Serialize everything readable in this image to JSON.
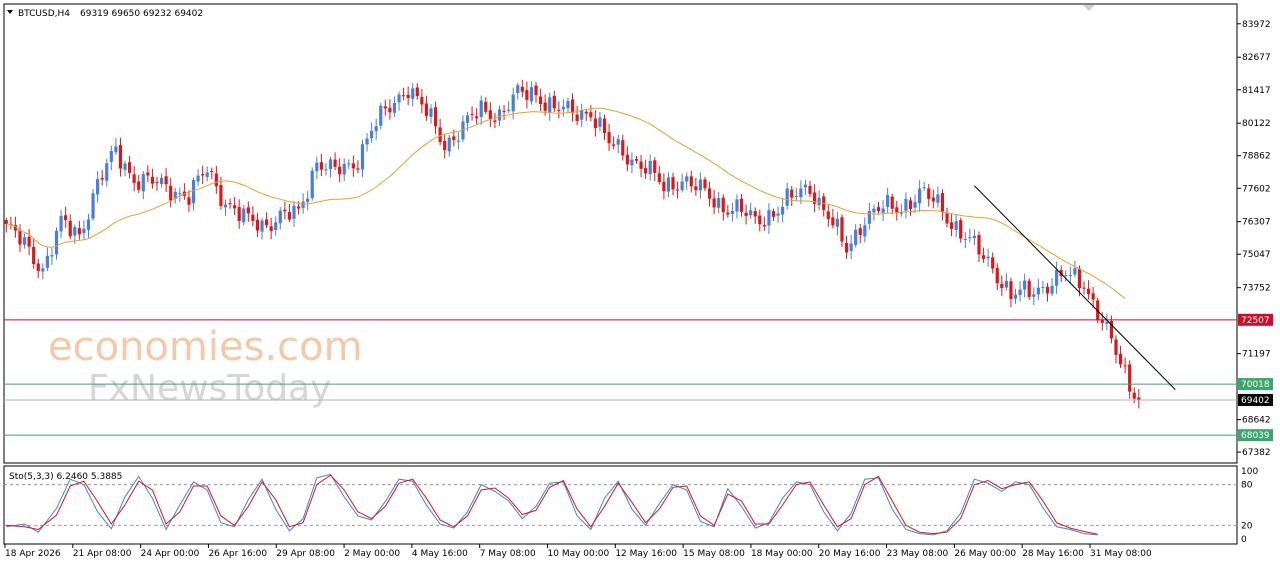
{
  "header": {
    "symbol": "BTCUSD,H4",
    "ohlc": "69319 69650 69232 69402"
  },
  "watermark": {
    "line1": "economies.com",
    "line2": "FxNewsToday"
  },
  "colors": {
    "bull": "#4a7fd4",
    "bear": "#d7191c",
    "ma": "#e8a032",
    "resistance": "#c8102e",
    "support": "#3aa86b",
    "current": "#000000",
    "trendline": "#000000",
    "stoch_main": "#4a7fd4",
    "stoch_signal": "#d7191c"
  },
  "chart_data": [
    {
      "type": "candlestick",
      "y_ticks": [
        "83972",
        "82677",
        "81417",
        "80122",
        "78862",
        "77602",
        "76307",
        "75047",
        "73752",
        "71197",
        "68642",
        "67382"
      ],
      "ylim": [
        67000,
        84700
      ],
      "x_labels": [
        "18 Apr 2026",
        "21 Apr 08:00",
        "24 Apr 00:00",
        "26 Apr 16:00",
        "29 Apr 08:00",
        "2 May 00:00",
        "4 May 16:00",
        "7 May 08:00",
        "10 May 00:00",
        "12 May 16:00",
        "15 May 08:00",
        "18 May 00:00",
        "20 May 16:00",
        "23 May 08:00",
        "26 May 00:00",
        "28 May 16:00",
        "31 May 08:00"
      ],
      "close_path": [
        [
          0,
          76100
        ],
        [
          4,
          75400
        ],
        [
          8,
          74500
        ],
        [
          12,
          76200
        ],
        [
          16,
          75800
        ],
        [
          20,
          77800
        ],
        [
          24,
          79000
        ],
        [
          28,
          78000
        ],
        [
          32,
          77800
        ],
        [
          36,
          77600
        ],
        [
          40,
          77300
        ],
        [
          44,
          78300
        ],
        [
          48,
          77100
        ],
        [
          52,
          76400
        ],
        [
          56,
          76200
        ],
        [
          60,
          76500
        ],
        [
          64,
          76600
        ],
        [
          68,
          78700
        ],
        [
          72,
          78200
        ],
        [
          76,
          78500
        ],
        [
          80,
          79900
        ],
        [
          84,
          80700
        ],
        [
          88,
          81600
        ],
        [
          92,
          80500
        ],
        [
          96,
          79300
        ],
        [
          100,
          80000
        ],
        [
          104,
          80600
        ],
        [
          108,
          80500
        ],
        [
          112,
          81200
        ],
        [
          116,
          81300
        ],
        [
          120,
          80700
        ],
        [
          124,
          80500
        ],
        [
          128,
          80600
        ],
        [
          132,
          79300
        ],
        [
          136,
          78900
        ],
        [
          140,
          78400
        ],
        [
          144,
          77600
        ],
        [
          148,
          78000
        ],
        [
          152,
          77500
        ],
        [
          156,
          77000
        ],
        [
          160,
          76800
        ],
        [
          164,
          76300
        ],
        [
          168,
          76700
        ],
        [
          172,
          77200
        ],
        [
          176,
          77700
        ],
        [
          180,
          76500
        ],
        [
          184,
          75200
        ],
        [
          188,
          76500
        ],
        [
          192,
          76800
        ],
        [
          196,
          76900
        ],
        [
          200,
          77400
        ],
        [
          204,
          77000
        ],
        [
          208,
          76100
        ],
        [
          212,
          75300
        ],
        [
          216,
          74600
        ],
        [
          220,
          73400
        ],
        [
          224,
          73600
        ],
        [
          228,
          73900
        ],
        [
          232,
          74200
        ],
        [
          236,
          74000
        ],
        [
          240,
          72400
        ],
        [
          244,
          70800
        ],
        [
          248,
          69402
        ]
      ],
      "resistance": 72507,
      "resistance_label": "72507",
      "support_1": 70018,
      "support_1_label": "70018",
      "support_2": 68039,
      "support_2_label": "68039",
      "current_price": 69402,
      "current_price_label": "69402",
      "trendline": {
        "start_bar": 212,
        "start": 77700,
        "end_bar": 256,
        "end": 69800
      }
    },
    {
      "type": "line",
      "title": "Sto(5,3,3) 6.2460 5.3885",
      "y_ticks": [
        "100",
        "80",
        "20",
        "0"
      ],
      "ylim": [
        0,
        100
      ],
      "levels": [
        80,
        20
      ],
      "series": [
        {
          "name": "main",
          "values": [
            [
              0,
              18
            ],
            [
              4,
              22
            ],
            [
              7,
              10
            ],
            [
              11,
              45
            ],
            [
              14,
              88
            ],
            [
              17,
              80
            ],
            [
              20,
              40
            ],
            [
              23,
              15
            ],
            [
              26,
              62
            ],
            [
              29,
              92
            ],
            [
              32,
              60
            ],
            [
              35,
              14
            ],
            [
              38,
              50
            ],
            [
              41,
              84
            ],
            [
              44,
              72
            ],
            [
              47,
              24
            ],
            [
              50,
              18
            ],
            [
              53,
              58
            ],
            [
              56,
              88
            ],
            [
              59,
              44
            ],
            [
              62,
              12
            ],
            [
              65,
              30
            ],
            [
              68,
              90
            ],
            [
              71,
              95
            ],
            [
              74,
              62
            ],
            [
              77,
              34
            ],
            [
              80,
              28
            ],
            [
              83,
              55
            ],
            [
              86,
              88
            ],
            [
              89,
              85
            ],
            [
              92,
              50
            ],
            [
              95,
              22
            ],
            [
              98,
              16
            ],
            [
              101,
              40
            ],
            [
              104,
              80
            ],
            [
              107,
              70
            ],
            [
              110,
              56
            ],
            [
              113,
              30
            ],
            [
              116,
              48
            ],
            [
              119,
              82
            ],
            [
              122,
              84
            ],
            [
              125,
              34
            ],
            [
              128,
              14
            ],
            [
              131,
              60
            ],
            [
              134,
              85
            ],
            [
              137,
              44
            ],
            [
              140,
              20
            ],
            [
              143,
              52
            ],
            [
              146,
              80
            ],
            [
              149,
              72
            ],
            [
              152,
              26
            ],
            [
              155,
              18
            ],
            [
              158,
              74
            ],
            [
              161,
              48
            ],
            [
              164,
              16
            ],
            [
              167,
              24
            ],
            [
              170,
              60
            ],
            [
              173,
              84
            ],
            [
              176,
              80
            ],
            [
              179,
              40
            ],
            [
              182,
              12
            ],
            [
              185,
              38
            ],
            [
              188,
              88
            ],
            [
              191,
              90
            ],
            [
              194,
              44
            ],
            [
              197,
              14
            ],
            [
              200,
              8
            ],
            [
              203,
              6
            ],
            [
              206,
              12
            ],
            [
              209,
              38
            ],
            [
              212,
              88
            ],
            [
              215,
              82
            ],
            [
              218,
              70
            ],
            [
              221,
              84
            ],
            [
              224,
              80
            ],
            [
              227,
              46
            ],
            [
              230,
              18
            ],
            [
              233,
              14
            ],
            [
              236,
              8
            ],
            [
              239,
              6
            ]
          ]
        },
        {
          "name": "signal",
          "values": [
            [
              0,
              20
            ],
            [
              4,
              18
            ],
            [
              7,
              14
            ],
            [
              11,
              35
            ],
            [
              14,
              78
            ],
            [
              17,
              85
            ],
            [
              20,
              55
            ],
            [
              23,
              22
            ],
            [
              26,
              50
            ],
            [
              29,
              85
            ],
            [
              32,
              72
            ],
            [
              35,
              22
            ],
            [
              38,
              40
            ],
            [
              41,
              78
            ],
            [
              44,
              78
            ],
            [
              47,
              34
            ],
            [
              50,
              20
            ],
            [
              53,
              48
            ],
            [
              56,
              84
            ],
            [
              59,
              58
            ],
            [
              62,
              18
            ],
            [
              65,
              24
            ],
            [
              68,
              80
            ],
            [
              71,
              94
            ],
            [
              74,
              72
            ],
            [
              77,
              40
            ],
            [
              80,
              30
            ],
            [
              83,
              48
            ],
            [
              86,
              82
            ],
            [
              89,
              88
            ],
            [
              92,
              60
            ],
            [
              95,
              28
            ],
            [
              98,
              18
            ],
            [
              101,
              34
            ],
            [
              104,
              72
            ],
            [
              107,
              75
            ],
            [
              110,
              60
            ],
            [
              113,
              36
            ],
            [
              116,
              42
            ],
            [
              119,
              76
            ],
            [
              122,
              86
            ],
            [
              125,
              44
            ],
            [
              128,
              18
            ],
            [
              131,
              48
            ],
            [
              134,
              82
            ],
            [
              137,
              54
            ],
            [
              140,
              24
            ],
            [
              143,
              44
            ],
            [
              146,
              76
            ],
            [
              149,
              78
            ],
            [
              152,
              34
            ],
            [
              155,
              20
            ],
            [
              158,
              66
            ],
            [
              161,
              56
            ],
            [
              164,
              22
            ],
            [
              167,
              22
            ],
            [
              170,
              50
            ],
            [
              173,
              80
            ],
            [
              176,
              84
            ],
            [
              179,
              50
            ],
            [
              182,
              18
            ],
            [
              185,
              30
            ],
            [
              188,
              80
            ],
            [
              191,
              92
            ],
            [
              194,
              56
            ],
            [
              197,
              20
            ],
            [
              200,
              10
            ],
            [
              203,
              8
            ],
            [
              206,
              10
            ],
            [
              209,
              30
            ],
            [
              212,
              80
            ],
            [
              215,
              86
            ],
            [
              218,
              74
            ],
            [
              221,
              80
            ],
            [
              224,
              84
            ],
            [
              227,
              56
            ],
            [
              230,
              24
            ],
            [
              233,
              16
            ],
            [
              236,
              11
            ],
            [
              239,
              7
            ]
          ]
        }
      ]
    }
  ]
}
